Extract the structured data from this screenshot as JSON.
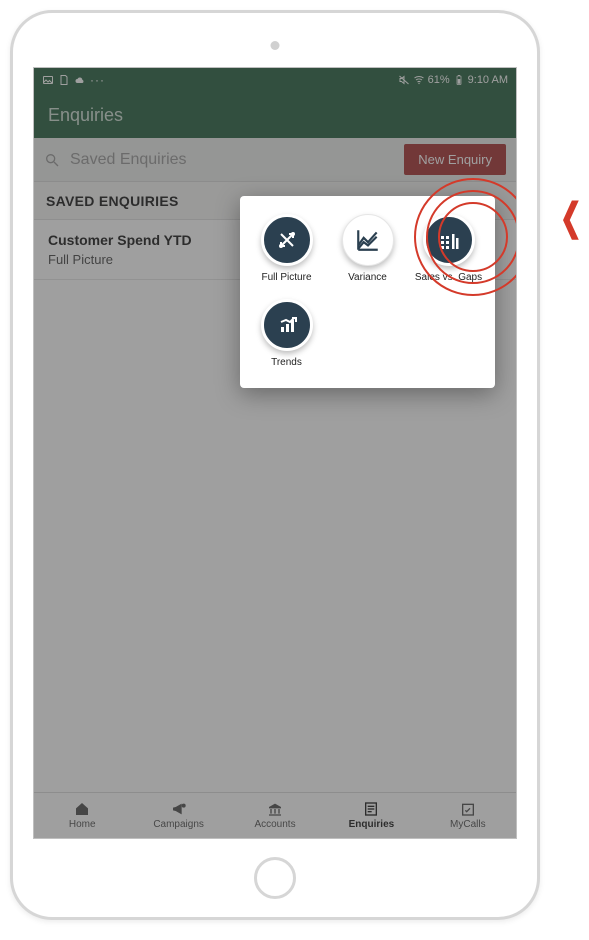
{
  "statusbar": {
    "battery_pct": "61%",
    "time": "9:10 AM"
  },
  "header": {
    "title": "Enquiries"
  },
  "search": {
    "placeholder": "Saved Enquiries"
  },
  "new_enquiry_label": "New Enquiry",
  "section": {
    "title": "SAVED ENQUIRIES"
  },
  "saved_items": [
    {
      "title": "Customer Spend YTD",
      "subtitle": "Full Picture"
    }
  ],
  "popup": {
    "items": [
      {
        "id": "full-picture",
        "label": "Full Picture",
        "icon": "arrows-cross"
      },
      {
        "id": "variance",
        "label": "Variance",
        "icon": "line-chart-outline"
      },
      {
        "id": "sales-vs-gaps",
        "label": "Sales vs. Gaps",
        "icon": "bar-dots"
      },
      {
        "id": "trends",
        "label": "Trends",
        "icon": "bar-growth"
      }
    ]
  },
  "bottom_nav": {
    "items": [
      {
        "id": "home",
        "label": "Home",
        "icon": "home"
      },
      {
        "id": "campaigns",
        "label": "Campaigns",
        "icon": "megaphone"
      },
      {
        "id": "accounts",
        "label": "Accounts",
        "icon": "bank"
      },
      {
        "id": "enquiries",
        "label": "Enquiries",
        "icon": "report",
        "active": true
      },
      {
        "id": "mycalls",
        "label": "MyCalls",
        "icon": "calendar"
      }
    ]
  },
  "callout": {
    "target": "sales-vs-gaps"
  },
  "colors": {
    "brand_green": "#0f4f2b",
    "brand_red": "#9c1c1c",
    "icon_navy": "#2b4050",
    "callout_red": "#d43a2a"
  }
}
